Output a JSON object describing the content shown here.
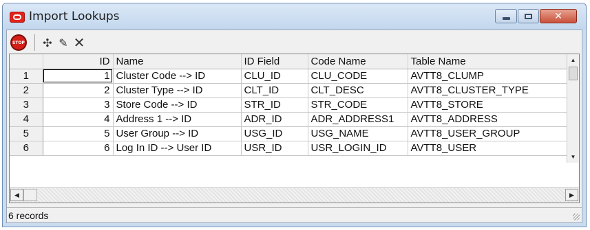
{
  "window": {
    "title": "Import Lookups",
    "minimize_glyph": "minimize",
    "maximize_glyph": "maximize",
    "close_label": "✕"
  },
  "toolbar": {
    "stop_label": "STOP",
    "add_glyph": "✣",
    "edit_glyph": "✎",
    "delete_glyph": "✕"
  },
  "grid": {
    "columns": [
      "",
      "ID",
      "Name",
      "ID Field",
      "Code Name",
      "Table Name"
    ],
    "rows": [
      {
        "num": "1",
        "id": "1",
        "name": "Cluster Code --> ID",
        "id_field": "CLU_ID",
        "code_name": "CLU_CODE",
        "table_name": "AVTT8_CLUMP"
      },
      {
        "num": "2",
        "id": "2",
        "name": "Cluster Type --> ID",
        "id_field": "CLT_ID",
        "code_name": "CLT_DESC",
        "table_name": "AVTT8_CLUSTER_TYPE"
      },
      {
        "num": "3",
        "id": "3",
        "name": "Store Code --> ID",
        "id_field": "STR_ID",
        "code_name": "STR_CODE",
        "table_name": "AVTT8_STORE"
      },
      {
        "num": "4",
        "id": "4",
        "name": "Address 1 --> ID",
        "id_field": "ADR_ID",
        "code_name": "ADR_ADDRESS1",
        "table_name": "AVTT8_ADDRESS"
      },
      {
        "num": "5",
        "id": "5",
        "name": "User Group --> ID",
        "id_field": "USG_ID",
        "code_name": "USG_NAME",
        "table_name": "AVTT8_USER_GROUP"
      },
      {
        "num": "6",
        "id": "6",
        "name": "Log In ID --> User ID",
        "id_field": "USR_ID",
        "code_name": "USR_LOGIN_ID",
        "table_name": "AVTT8_USER"
      }
    ]
  },
  "status": {
    "text": "6 records"
  },
  "colors": {
    "titlebar": "#c2d7ee",
    "close_button": "#c9503a",
    "stop_button": "#d42018"
  }
}
